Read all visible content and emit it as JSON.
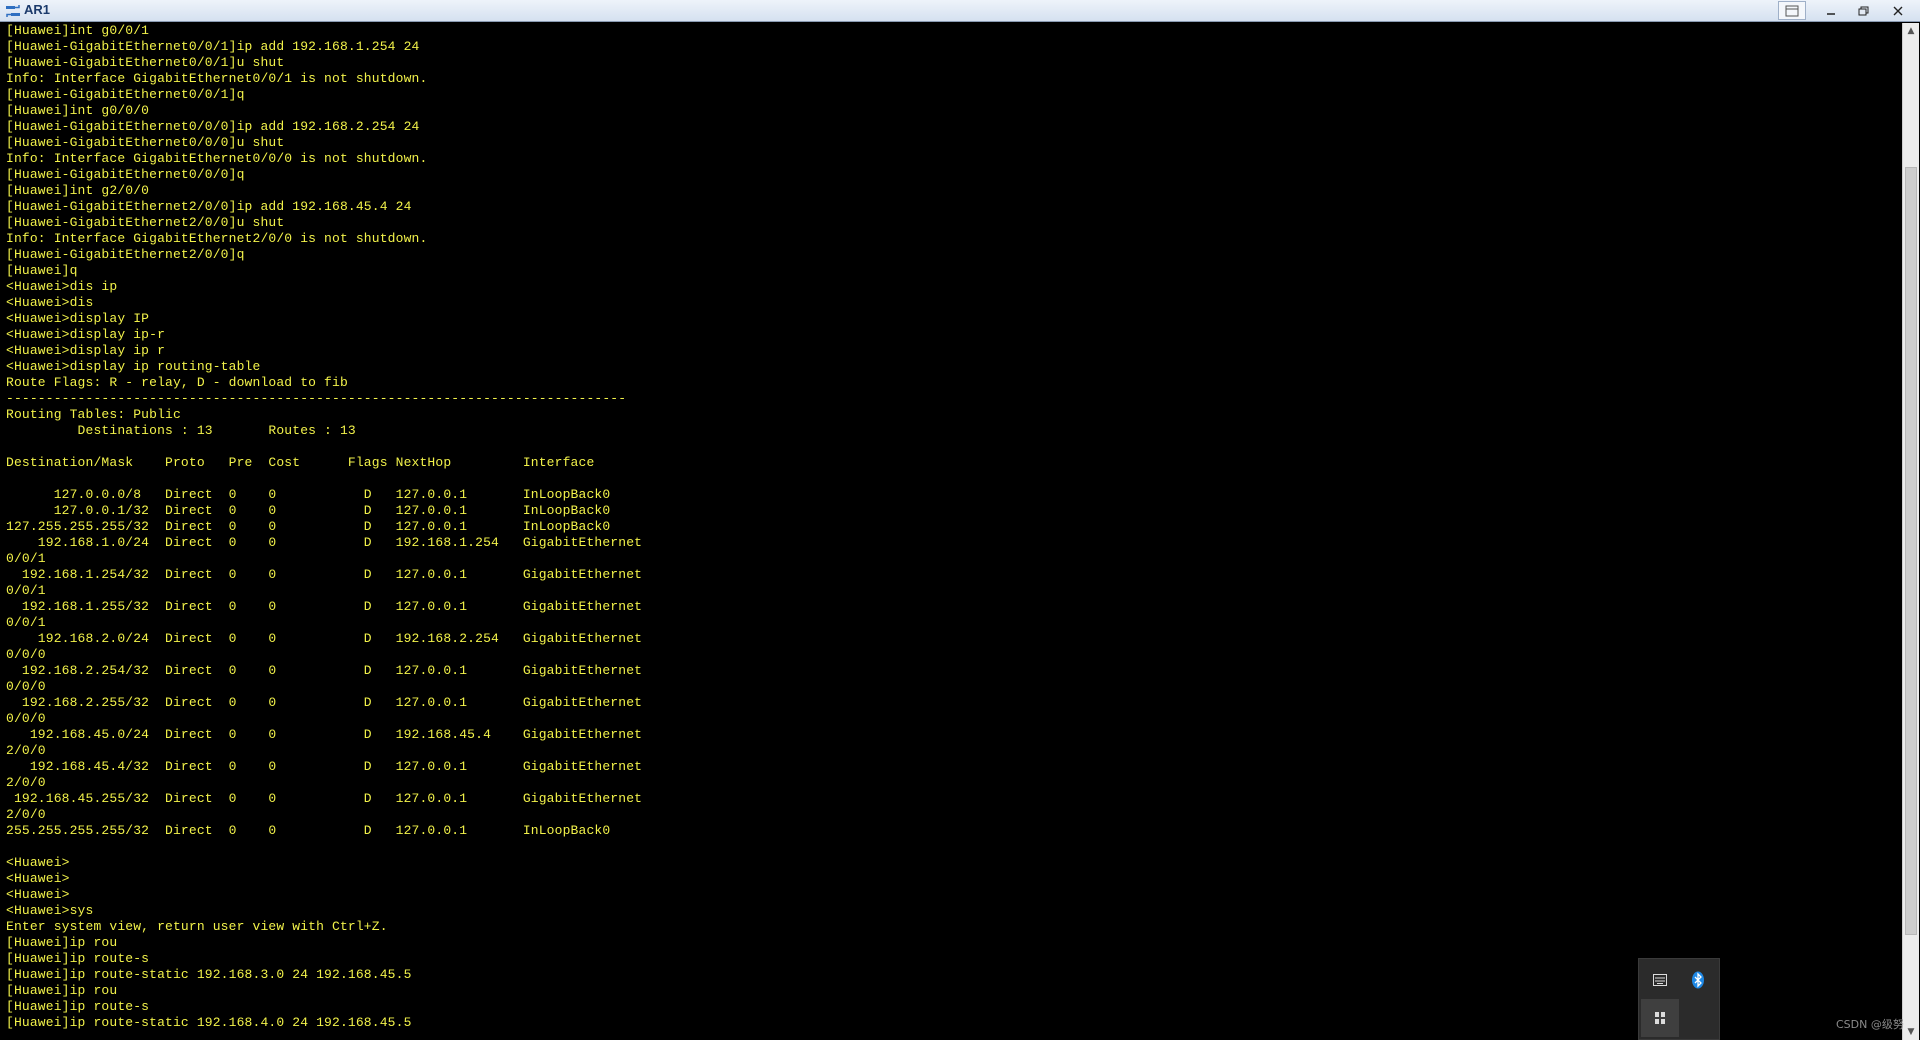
{
  "window": {
    "title": "AR1",
    "controls": [
      "restore-extra-icon",
      "minimize-icon",
      "maximize-icon",
      "close-icon"
    ]
  },
  "terminal": {
    "text_color": "#f2f24a",
    "background": "#000000",
    "lines": [
      "[Huawei]int g0/0/1",
      "[Huawei-GigabitEthernet0/0/1]ip add 192.168.1.254 24",
      "[Huawei-GigabitEthernet0/0/1]u shut",
      "Info: Interface GigabitEthernet0/0/1 is not shutdown.",
      "[Huawei-GigabitEthernet0/0/1]q",
      "[Huawei]int g0/0/0",
      "[Huawei-GigabitEthernet0/0/0]ip add 192.168.2.254 24",
      "[Huawei-GigabitEthernet0/0/0]u shut",
      "Info: Interface GigabitEthernet0/0/0 is not shutdown.",
      "[Huawei-GigabitEthernet0/0/0]q",
      "[Huawei]int g2/0/0",
      "[Huawei-GigabitEthernet2/0/0]ip add 192.168.45.4 24",
      "[Huawei-GigabitEthernet2/0/0]u shut",
      "Info: Interface GigabitEthernet2/0/0 is not shutdown.",
      "[Huawei-GigabitEthernet2/0/0]q",
      "[Huawei]q",
      "<Huawei>dis ip",
      "<Huawei>dis",
      "<Huawei>display IP",
      "<Huawei>display ip-r",
      "<Huawei>display ip r",
      "<Huawei>display ip routing-table",
      "Route Flags: R - relay, D - download to fib",
      "------------------------------------------------------------------------------",
      "Routing Tables: Public",
      "         Destinations : 13       Routes : 13",
      "",
      "Destination/Mask    Proto   Pre  Cost      Flags NextHop         Interface",
      "",
      "      127.0.0.0/8   Direct  0    0           D   127.0.0.1       InLoopBack0",
      "      127.0.0.1/32  Direct  0    0           D   127.0.0.1       InLoopBack0",
      "127.255.255.255/32  Direct  0    0           D   127.0.0.1       InLoopBack0",
      "    192.168.1.0/24  Direct  0    0           D   192.168.1.254   GigabitEthernet",
      "0/0/1",
      "  192.168.1.254/32  Direct  0    0           D   127.0.0.1       GigabitEthernet",
      "0/0/1",
      "  192.168.1.255/32  Direct  0    0           D   127.0.0.1       GigabitEthernet",
      "0/0/1",
      "    192.168.2.0/24  Direct  0    0           D   192.168.2.254   GigabitEthernet",
      "0/0/0",
      "  192.168.2.254/32  Direct  0    0           D   127.0.0.1       GigabitEthernet",
      "0/0/0",
      "  192.168.2.255/32  Direct  0    0           D   127.0.0.1       GigabitEthernet",
      "0/0/0",
      "   192.168.45.0/24  Direct  0    0           D   192.168.45.4    GigabitEthernet",
      "2/0/0",
      "   192.168.45.4/32  Direct  0    0           D   127.0.0.1       GigabitEthernet",
      "2/0/0",
      " 192.168.45.255/32  Direct  0    0           D   127.0.0.1       GigabitEthernet",
      "2/0/0",
      "255.255.255.255/32  Direct  0    0           D   127.0.0.1       InLoopBack0",
      "",
      "<Huawei>",
      "<Huawei>",
      "<Huawei>",
      "<Huawei>sys",
      "Enter system view, return user view with Ctrl+Z.",
      "[Huawei]ip rou",
      "[Huawei]ip route-s",
      "[Huawei]ip route-static 192.168.3.0 24 192.168.45.5",
      "[Huawei]ip rou",
      "[Huawei]ip route-s",
      "[Huawei]ip route-static 192.168.4.0 24 192.168.45.5"
    ]
  },
  "scrollbar": {
    "position_fraction": 0.13,
    "visible_fraction": 0.78
  },
  "tray_popup": {
    "items": [
      "keyboard-icon",
      "bluetooth-icon",
      "pin-icon"
    ],
    "bluetooth_color": "#1e88e5"
  },
  "watermark": {
    "text": "CSDN @级努"
  }
}
